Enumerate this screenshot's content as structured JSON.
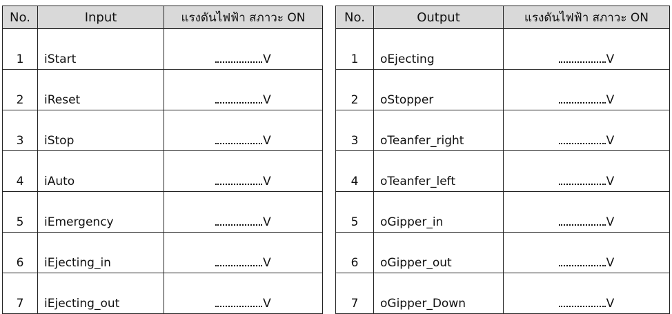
{
  "input_table": {
    "headers": [
      "No.",
      "Input",
      "แรงดันไฟฟ้า สภาวะ ON"
    ],
    "rows": [
      {
        "no": "1",
        "name": "iStart",
        "unit": "V"
      },
      {
        "no": "2",
        "name": "iReset",
        "unit": "V"
      },
      {
        "no": "3",
        "name": "iStop",
        "unit": "V"
      },
      {
        "no": "4",
        "name": "iAuto",
        "unit": "V"
      },
      {
        "no": "5",
        "name": "iEmergency",
        "unit": "V"
      },
      {
        "no": "6",
        "name": "iEjecting_in",
        "unit": "V"
      },
      {
        "no": "7",
        "name": "iEjecting_out",
        "unit": "V"
      }
    ]
  },
  "output_table": {
    "headers": [
      "No.",
      "Output",
      "แรงดันไฟฟ้า สภาวะ ON"
    ],
    "rows": [
      {
        "no": "1",
        "name": "oEjecting",
        "unit": "V"
      },
      {
        "no": "2",
        "name": "oStopper",
        "unit": "V"
      },
      {
        "no": "3",
        "name": "oTeanfer_right",
        "unit": "V"
      },
      {
        "no": "4",
        "name": "oTeanfer_left",
        "unit": "V"
      },
      {
        "no": "5",
        "name": "oGipper_in",
        "unit": "V"
      },
      {
        "no": "6",
        "name": "oGipper_out",
        "unit": "V"
      },
      {
        "no": "7",
        "name": "oGipper_Down",
        "unit": "V"
      }
    ]
  }
}
